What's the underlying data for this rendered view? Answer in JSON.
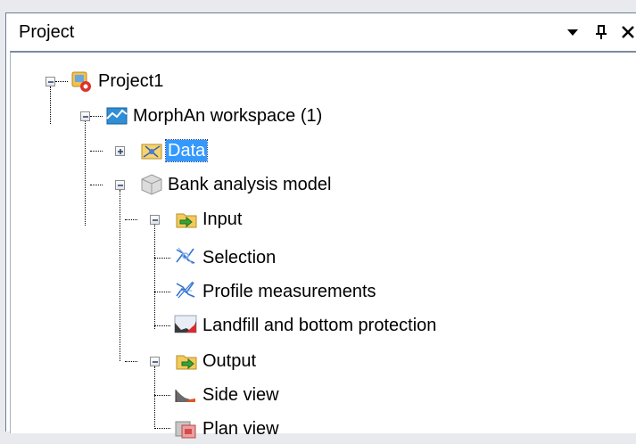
{
  "panel": {
    "title": "Project",
    "header_icons": [
      "dropdown-arrow-icon",
      "pin-icon",
      "close-icon"
    ]
  },
  "tree": {
    "project": {
      "label": "Project1",
      "icon": "project-icon",
      "expanded": true
    },
    "workspace": {
      "label": "MorphAn workspace (1)",
      "icon": "workspace-icon",
      "expanded": true
    },
    "data": {
      "label": "Data",
      "icon": "data-icon",
      "expanded": false,
      "selected": true
    },
    "model": {
      "label": "Bank analysis model",
      "icon": "model-icon",
      "expanded": true
    },
    "input": {
      "label": "Input",
      "icon": "input-folder-icon",
      "expanded": true
    },
    "selection": {
      "label": "Selection",
      "icon": "selection-icon"
    },
    "profiles": {
      "label": "Profile measurements",
      "icon": "profile-measurements-icon"
    },
    "landfill": {
      "label": "Landfill and bottom protection",
      "icon": "landfill-icon"
    },
    "output": {
      "label": "Output",
      "icon": "output-folder-icon",
      "expanded": true
    },
    "side_view": {
      "label": "Side view",
      "icon": "side-view-icon"
    },
    "plan_view": {
      "label": "Plan view",
      "icon": "plan-view-icon"
    }
  },
  "colors": {
    "selection_bg": "#3399ff",
    "panel_border": "#6f7f95"
  }
}
